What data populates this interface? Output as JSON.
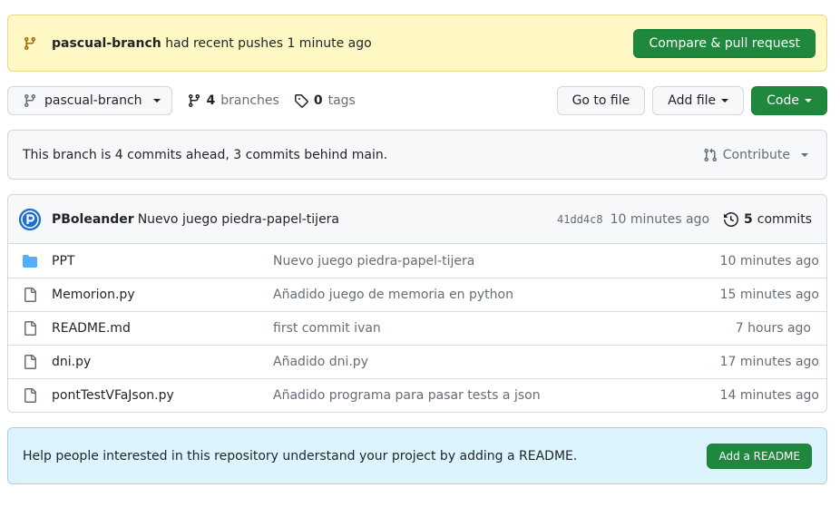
{
  "push_banner": {
    "branch": "pascual-branch",
    "message": "had recent pushes 1 minute ago",
    "button": "Compare & pull request"
  },
  "toolbar": {
    "branch_selector": "pascual-branch",
    "branches_count": "4",
    "branches_label": "branches",
    "tags_count": "0",
    "tags_label": "tags",
    "go_to_file": "Go to file",
    "add_file": "Add file",
    "code": "Code"
  },
  "compare": {
    "text": "This branch is 4 commits ahead, 3 commits behind main.",
    "contribute": "Contribute"
  },
  "latest_commit": {
    "author": "PBoleander",
    "message": "Nuevo juego piedra-papel-tijera",
    "sha": "41dd4c8",
    "time": "10 minutes ago",
    "commits_count": "5",
    "commits_label": "commits"
  },
  "files": [
    {
      "name": "PPT",
      "type": "folder",
      "commit": "Nuevo juego piedra-papel-tijera",
      "age": "10 minutes ago"
    },
    {
      "name": "Memorion.py",
      "type": "file",
      "commit": "Añadido juego de memoria en python",
      "age": "15 minutes ago"
    },
    {
      "name": "README.md",
      "type": "file",
      "commit": "first commit ivan",
      "age": "7 hours ago"
    },
    {
      "name": "dni.py",
      "type": "file",
      "commit": "Añadido dni.py",
      "age": "17 minutes ago"
    },
    {
      "name": "pontTestVFaJson.py",
      "type": "file",
      "commit": "Añadido programa para pasar tests a json",
      "age": "14 minutes ago"
    }
  ],
  "readme_banner": {
    "text": "Help people interested in this repository understand your project by adding a README.",
    "button": "Add a README"
  },
  "colors": {
    "green": "#1f883d",
    "banner_yellow": "#fff8c5",
    "banner_blue": "#ddf4ff",
    "folder_blue": "#54aeff"
  }
}
